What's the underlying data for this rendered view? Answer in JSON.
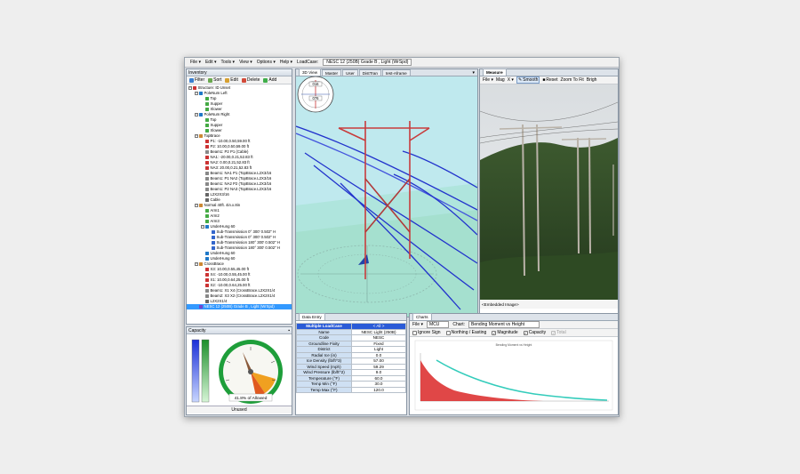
{
  "menu": {
    "items": [
      "File ▾",
      "Edit ▾",
      "Tools ▾",
      "View ▾",
      "Options ▾",
      "Help ▾"
    ],
    "loadcase_label": "LoadCase:",
    "loadcase_value": "NESC 12 (250B) Grade B , Light (WrSpd)"
  },
  "inventory": {
    "title": "Inventory",
    "toolbar": {
      "filter": "Filter",
      "sort": "Sort",
      "edit": "Edit",
      "delete": "Delete",
      "add": "Add"
    },
    "nodes": [
      {
        "label": "Structure: ID Unset",
        "depth": 0,
        "exp": "−",
        "color": "#cc3333"
      },
      {
        "label": "PoleNum Left",
        "depth": 1,
        "exp": "−",
        "color": "#1f78c8"
      },
      {
        "label": "Top",
        "depth": 2,
        "exp": "",
        "color": "#44aa44"
      },
      {
        "label": "Xupper",
        "depth": 2,
        "exp": "",
        "color": "#44aa44"
      },
      {
        "label": "Xlower",
        "depth": 2,
        "exp": "",
        "color": "#44aa44"
      },
      {
        "label": "PoleNum Right",
        "depth": 1,
        "exp": "−",
        "color": "#1f78c8"
      },
      {
        "label": "Top",
        "depth": 2,
        "exp": "",
        "color": "#44aa44"
      },
      {
        "label": "Xupper",
        "depth": 2,
        "exp": "",
        "color": "#44aa44"
      },
      {
        "label": "Xlower",
        "depth": 2,
        "exp": "",
        "color": "#44aa44"
      },
      {
        "label": "TopBrace",
        "depth": 1,
        "exp": "−",
        "color": "#cc8833"
      },
      {
        "label": "P1: -10.00,0.50,59.00 ft",
        "depth": 2,
        "exp": "",
        "color": "#cc3333"
      },
      {
        "label": "P2: 10.00,0.50,59.00 ft",
        "depth": 2,
        "exp": "",
        "color": "#cc3333"
      },
      {
        "label": "Beam1: P2 P1 (Cable)",
        "depth": 2,
        "exp": "",
        "color": "#888888"
      },
      {
        "label": "NA1: -20.00,0.21,52.83 ft",
        "depth": 2,
        "exp": "",
        "color": "#cc3333"
      },
      {
        "label": "NA2: 0.00,0.21,52.83 ft",
        "depth": 2,
        "exp": "",
        "color": "#cc3333"
      },
      {
        "label": "NA3: 20.00,0.21,52.83 ft",
        "depth": 2,
        "exp": "",
        "color": "#cc3333"
      },
      {
        "label": "Beam1: NA1 P1 (TopBrace.L2X3/16",
        "depth": 2,
        "exp": "",
        "color": "#888888"
      },
      {
        "label": "Beam1: P1 NA2 (TopBrace.L2X3/16",
        "depth": 2,
        "exp": "",
        "color": "#888888"
      },
      {
        "label": "Beam1: NA2 P2 (TopBrace.L2X3/16",
        "depth": 2,
        "exp": "",
        "color": "#888888"
      },
      {
        "label": "Beam1: P2 NA3 (TopBrace.L2X3/16",
        "depth": 2,
        "exp": "",
        "color": "#888888"
      },
      {
        "label": "L2X2X3/16",
        "depth": 2,
        "exp": "",
        "color": "#666666"
      },
      {
        "label": "Cable",
        "depth": 2,
        "exp": "",
        "color": "#666666"
      },
      {
        "label": "Normal 40ft. 4in.x.8in",
        "depth": 1,
        "exp": "−",
        "color": "#cc8833"
      },
      {
        "label": "Arm1",
        "depth": 2,
        "exp": "",
        "color": "#44aa44"
      },
      {
        "label": "Arm2",
        "depth": 2,
        "exp": "",
        "color": "#44aa44"
      },
      {
        "label": "Arm3",
        "depth": 2,
        "exp": "",
        "color": "#44aa44"
      },
      {
        "label": "UnderHung 60",
        "depth": 2,
        "exp": "−",
        "color": "#1f78c8"
      },
      {
        "label": "Sub-Transmission 0° 300' 0.502\" H",
        "depth": 3,
        "exp": "",
        "color": "#3366cc"
      },
      {
        "label": "Sub-Transmission 0° 300' 0.502\" H",
        "depth": 3,
        "exp": "",
        "color": "#3366cc"
      },
      {
        "label": "Sub-Transmission 180° 300' 0.502\" H",
        "depth": 3,
        "exp": "",
        "color": "#3366cc"
      },
      {
        "label": "Sub-Transmission 180° 300' 0.502\" H",
        "depth": 3,
        "exp": "",
        "color": "#3366cc"
      },
      {
        "label": "UnderHung 60",
        "depth": 2,
        "exp": "",
        "color": "#1f78c8"
      },
      {
        "label": "UnderHung 60",
        "depth": 2,
        "exp": "",
        "color": "#1f78c8"
      },
      {
        "label": "CrossBrace",
        "depth": 1,
        "exp": "−",
        "color": "#cc8833"
      },
      {
        "label": "X3: 10.00,0.55,45.00 ft",
        "depth": 2,
        "exp": "",
        "color": "#cc3333"
      },
      {
        "label": "X4: -10.00,0.55,45.00 ft",
        "depth": 2,
        "exp": "",
        "color": "#cc3333"
      },
      {
        "label": "X1: 10.00,0.64,25.00 ft",
        "depth": 2,
        "exp": "",
        "color": "#cc3333"
      },
      {
        "label": "X2: -10.00,0.64,25.00 ft",
        "depth": 2,
        "exp": "",
        "color": "#cc3333"
      },
      {
        "label": "Beam1: X1 X4 (CrossBrace.L2X2X1/4",
        "depth": 2,
        "exp": "",
        "color": "#888888"
      },
      {
        "label": "Beam2: X3 X2 (CrossBrace.L2X2X1/4",
        "depth": 2,
        "exp": "",
        "color": "#888888"
      },
      {
        "label": "L2X2X1/4",
        "depth": 2,
        "exp": "",
        "color": "#666666"
      },
      {
        "label": "NESC 12 (250B) Grade B , Light (WrSpd)",
        "depth": 1,
        "exp": "",
        "color": "#7744cc",
        "selected": true
      }
    ]
  },
  "view3d": {
    "tabs": [
      "3D View",
      "Master",
      "User",
      "DistTran",
      "test-Aframe"
    ],
    "compass_top": "016",
    "compass_bottom": "076"
  },
  "measure": {
    "title": "Measure",
    "toolbar": {
      "file": "File ▾",
      "mag": "Mag",
      "x": "X ▾",
      "smooth": "Smooth",
      "reset": "Reset",
      "zoom": "Zoom To Fit",
      "brightness": "Brigh"
    },
    "caption": "<Embedded Image>"
  },
  "capacity": {
    "title": "Capacity",
    "readout": "41.8% of Allowed",
    "status": "Unused",
    "percent": 41.8
  },
  "data_entry": {
    "tab": "Data Entry",
    "header_left": "Multiple LoadCase",
    "header_right": "< All >",
    "rows": [
      {
        "k": "Name",
        "v": "NESC Light (250B)"
      },
      {
        "k": "Code",
        "v": "NESC"
      },
      {
        "k": "Groundline Fixity",
        "v": "Fixed"
      },
      {
        "k": "District",
        "v": "Light"
      },
      {
        "k": "Radial Ice (in)",
        "v": "0.0"
      },
      {
        "k": "Ice Density (lb/ft^3)",
        "v": "57.00"
      },
      {
        "k": "Wind Speed (mph)",
        "v": "59.29"
      },
      {
        "k": "Wind Pressure (lb/ft^2)",
        "v": "9.0"
      },
      {
        "k": "Temperature (°F)",
        "v": "60.0"
      },
      {
        "k": "Temp Min (°F)",
        "v": "30.0"
      },
      {
        "k": "Temp Max (°F)",
        "v": "120.0"
      }
    ]
  },
  "charts": {
    "tab": "Charts",
    "file": "File ▾",
    "mcu": "MCU",
    "chart_label": "Chart:",
    "chart_value": "Bending Moment vs Height",
    "ignore_sign": "Ignore Sign",
    "northing": "Northing / Easting",
    "magnitude": "Magnitude",
    "capacity": "Capacity",
    "total": "Total",
    "plot_title": "Bending Moment vs Height",
    "colors": {
      "capacity": "#33ccbb",
      "moment": "#dd3333"
    }
  },
  "colors": {
    "sky": "#bfe9ee",
    "pole": "#c83c3c",
    "wire": "#2233cc",
    "panel_border": "#8a96a4"
  }
}
